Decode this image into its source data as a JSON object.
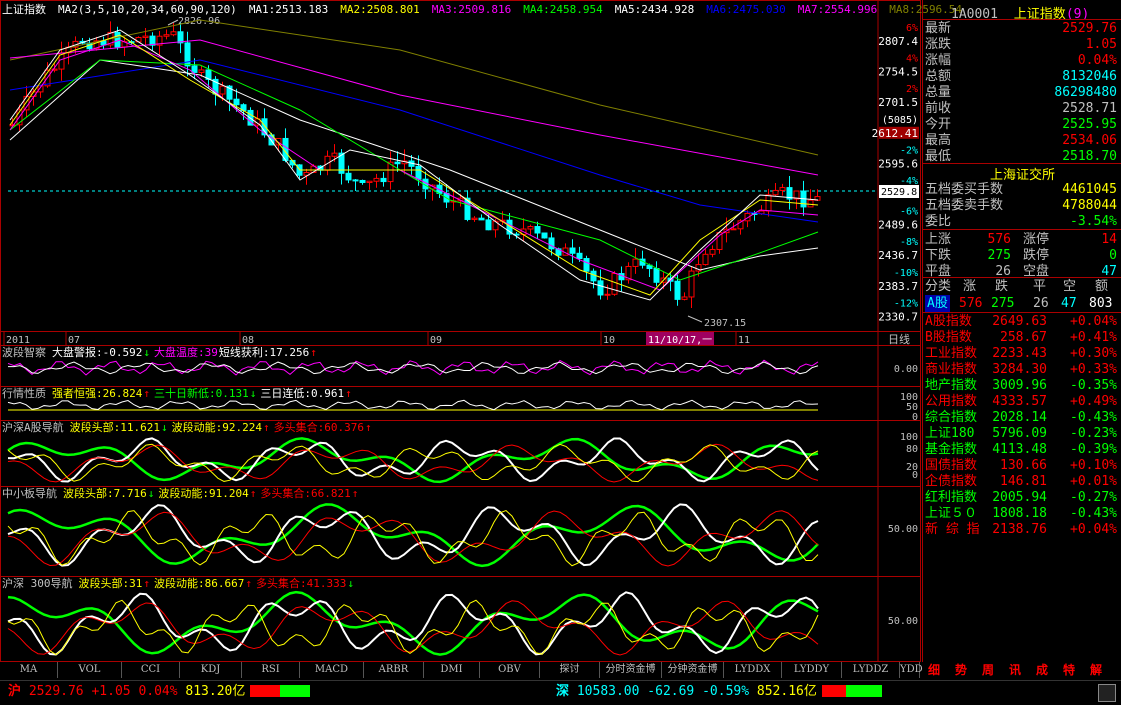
{
  "main_chart": {
    "title": "上证指数",
    "ma_legend": [
      {
        "text": "MA2(3,5,10,20,34,60,90,120)",
        "color": "#ffffff"
      },
      {
        "text": "MA1:2513.183",
        "color": "#ffffff"
      },
      {
        "text": "MA2:2508.801",
        "color": "#ffff00"
      },
      {
        "text": "MA3:2509.816",
        "color": "#ff00ff"
      },
      {
        "text": "MA4:2458.954",
        "color": "#00ff00"
      },
      {
        "text": "MA5:2434.928",
        "color": "#ffffff"
      },
      {
        "text": "MA6:2475.030",
        "color": "#0000ff"
      },
      {
        "text": "MA7:2554.996",
        "color": "#ff00ff"
      },
      {
        "text": "MA8:2596.54",
        "color": "#808000"
      }
    ],
    "high_label": "2826.96",
    "low_label": "2307.15",
    "date_cursor": "11/10/17,一",
    "current_price_box": "2529.8",
    "y_axis": [
      {
        "pct": "6%",
        "price": "2807.4"
      },
      {
        "pct": "4%",
        "price": "2754.5"
      },
      {
        "pct": "2%",
        "price": "2701.5"
      },
      {
        "pct": "(5085)",
        "price": "2612.41"
      },
      {
        "pct": "-2%",
        "price": "2595.6"
      },
      {
        "pct": "-4%",
        "price": ""
      },
      {
        "pct": "-6%",
        "price": "2489.6"
      },
      {
        "pct": "-8%",
        "price": "2436.7"
      },
      {
        "pct": "-10%",
        "price": "2383.7"
      },
      {
        "pct": "-12%",
        "price": "2330.7"
      }
    ],
    "x_axis": [
      "2011",
      "07",
      "08",
      "09",
      "10",
      "11"
    ],
    "period_label": "日线"
  },
  "panels": [
    {
      "title": "波段智察",
      "items": [
        {
          "text": "大盘警报:-0.592",
          "color": "#ffffff"
        },
        {
          "text": "↓",
          "color": "#00ff00"
        },
        {
          "text": "大盘温度:39",
          "color": "#ff00ff"
        },
        {
          "text": "短线获利:17.256",
          "color": "#ffffff"
        },
        {
          "text": "↑",
          "color": "#ff0000"
        }
      ],
      "axis": [
        "0.00"
      ]
    },
    {
      "title": "行情性质",
      "items": [
        {
          "text": "强者恒强:26.824",
          "color": "#ffff00"
        },
        {
          "text": "↑",
          "color": "#ff0000"
        },
        {
          "text": "三十日新低:0.131",
          "color": "#00ff00"
        },
        {
          "text": "↓",
          "color": "#00ff00"
        },
        {
          "text": "三日连低:0.961",
          "color": "#ffffff"
        },
        {
          "text": "↑",
          "color": "#ff0000"
        }
      ],
      "axis": [
        "100",
        "50",
        "0"
      ]
    },
    {
      "title": "沪深A股导航",
      "items": [
        {
          "text": "波段头部:11.621",
          "color": "#ffff00"
        },
        {
          "text": "↓",
          "color": "#00ff00"
        },
        {
          "text": "波段动能:92.224",
          "color": "#ffff00"
        },
        {
          "text": "↑",
          "color": "#ff0000"
        },
        {
          "text": "多头集合:60.376",
          "color": "#ff0000"
        },
        {
          "text": "↑",
          "color": "#ff0000"
        }
      ],
      "axis": [
        "100",
        "80",
        "20",
        "0"
      ]
    },
    {
      "title": "中小板导航",
      "items": [
        {
          "text": "波段头部:7.716",
          "color": "#ffff00"
        },
        {
          "text": "↓",
          "color": "#00ff00"
        },
        {
          "text": "波段动能:91.204",
          "color": "#ffff00"
        },
        {
          "text": "↑",
          "color": "#ff0000"
        },
        {
          "text": "多头集合:66.821",
          "color": "#ff0000"
        },
        {
          "text": "↑",
          "color": "#ff0000"
        }
      ],
      "axis": [
        "50.00"
      ]
    },
    {
      "title": "沪深 300导航",
      "items": [
        {
          "text": "波段头部:31",
          "color": "#ffff00"
        },
        {
          "text": "↑",
          "color": "#ff0000"
        },
        {
          "text": "波段动能:86.667",
          "color": "#ffff00"
        },
        {
          "text": "↑",
          "color": "#ff0000"
        },
        {
          "text": "多头集合:41.333",
          "color": "#ff0000"
        },
        {
          "text": "↓",
          "color": "#00ff00"
        }
      ],
      "axis": [
        "50.00"
      ]
    }
  ],
  "bottom_tabs": [
    "MA",
    "VOL",
    "CCI",
    "KDJ",
    "RSI",
    "MACD",
    "ARBR",
    "DMI",
    "OBV",
    "探讨",
    "分时资金博",
    "分钟资金博",
    "LYDDX",
    "LYDDY",
    "LYDDZ",
    "YDD"
  ],
  "right_panel": {
    "code": "1A0001",
    "name": "上证指数",
    "name_suffix": "(9)",
    "quote": [
      {
        "label": "最新",
        "value": "2529.76",
        "color": "#ff0000"
      },
      {
        "label": "涨跌",
        "value": "1.05",
        "color": "#ff0000"
      },
      {
        "label": "涨幅",
        "value": "0.04%",
        "color": "#ff0000"
      },
      {
        "label": "总额",
        "value": "8132046",
        "color": "#00ffff"
      },
      {
        "label": "总量",
        "value": "86298480",
        "color": "#00ffff"
      },
      {
        "label": "前收",
        "value": "2528.71",
        "color": "#c0c0c0"
      },
      {
        "label": "今开",
        "value": "2525.95",
        "color": "#00ff00"
      },
      {
        "label": "最高",
        "value": "2534.06",
        "color": "#ff0000"
      },
      {
        "label": "最低",
        "value": "2518.70",
        "color": "#00ff00"
      }
    ],
    "exchange_title": "上海证交所",
    "depth": [
      {
        "label": "五档委买手数",
        "value": "4461045",
        "color": "#ffff00"
      },
      {
        "label": "五档委卖手数",
        "value": "4788044",
        "color": "#ffff00"
      },
      {
        "label": "委比",
        "value": "-3.54%",
        "color": "#00ff00"
      }
    ],
    "breadth": [
      {
        "l1": "上涨",
        "v1": "576",
        "c1": "#ff0000",
        "l2": "涨停",
        "v2": "14",
        "c2": "#ff0000"
      },
      {
        "l1": "下跌",
        "v1": "275",
        "c1": "#00ff00",
        "l2": "跌停",
        "v2": "0",
        "c2": "#00ff00"
      },
      {
        "l1": "平盘",
        "v1": "26",
        "c1": "#c0c0c0",
        "l2": "空盘",
        "v2": "47",
        "c2": "#00ffff"
      }
    ],
    "class_header": [
      "分类",
      "涨",
      "跌",
      "平",
      "空",
      "额"
    ],
    "class_row": {
      "label": "A股",
      "up": "576",
      "down": "275",
      "flat": "26",
      "empty": "47",
      "amount": "803"
    },
    "indices": [
      {
        "name": "A股指数",
        "price": "2649.63",
        "chg": "+0.04%",
        "color": "#ff0000"
      },
      {
        "name": "B股指数",
        "price": "258.67",
        "chg": "+0.41%",
        "color": "#ff0000"
      },
      {
        "name": "工业指数",
        "price": "2233.43",
        "chg": "+0.30%",
        "color": "#ff0000"
      },
      {
        "name": "商业指数",
        "price": "3284.30",
        "chg": "+0.33%",
        "color": "#ff0000"
      },
      {
        "name": "地产指数",
        "price": "3009.96",
        "chg": "-0.35%",
        "color": "#00ff00"
      },
      {
        "name": "公用指数",
        "price": "4333.57",
        "chg": "+0.49%",
        "color": "#ff0000"
      },
      {
        "name": "综合指数",
        "price": "2028.14",
        "chg": "-0.43%",
        "color": "#00ff00"
      },
      {
        "name": "上证180",
        "price": "5796.09",
        "chg": "-0.23%",
        "color": "#00ff00"
      },
      {
        "name": "基金指数",
        "price": "4113.48",
        "chg": "-0.39%",
        "color": "#00ff00"
      },
      {
        "name": "国债指数",
        "price": "130.66",
        "chg": "+0.10%",
        "color": "#ff0000"
      },
      {
        "name": "企债指数",
        "price": "146.81",
        "chg": "+0.01%",
        "color": "#ff0000"
      },
      {
        "name": "红利指数",
        "price": "2005.94",
        "chg": "-0.27%",
        "color": "#00ff00"
      },
      {
        "name": "上证５０",
        "price": "1808.18",
        "chg": "-0.43%",
        "color": "#00ff00"
      },
      {
        "name": "新 综 指",
        "price": "2138.76",
        "chg": "+0.04%",
        "color": "#ff0000"
      }
    ],
    "tabs": [
      "细",
      "势",
      "周",
      "讯",
      "成",
      "特",
      "解"
    ]
  },
  "status_bar": {
    "sh_label": "沪",
    "sh_price": "2529.76",
    "sh_change": "+1.05",
    "sh_pct": "0.04%",
    "sh_amount": "813.20亿",
    "sz_label": "深",
    "sz_price": "10583.00",
    "sz_change": "-62.69",
    "sz_pct": "-0.59%",
    "sz_amount": "852.16亿"
  },
  "colors": {
    "up": "#ff0000",
    "down": "#00ffff",
    "border": "#aa0000",
    "label": "#ffff00"
  }
}
